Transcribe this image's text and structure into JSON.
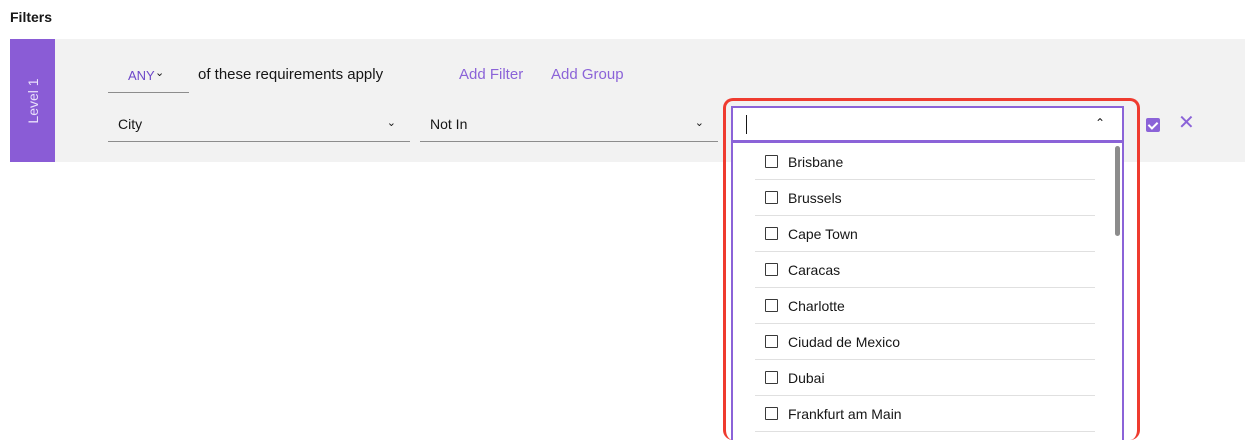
{
  "header": {
    "title": "Filters"
  },
  "level": {
    "label": "Level 1"
  },
  "requirement": {
    "quantifier": "ANY",
    "text": "of these requirements apply",
    "add_filter": "Add Filter",
    "add_group": "Add Group"
  },
  "filter": {
    "field_value": "City",
    "operator_value": "Not In",
    "search_value": ""
  },
  "options": [
    {
      "label": "Brisbane",
      "checked": false
    },
    {
      "label": "Brussels",
      "checked": false
    },
    {
      "label": "Cape Town",
      "checked": false
    },
    {
      "label": "Caracas",
      "checked": false
    },
    {
      "label": "Charlotte",
      "checked": false
    },
    {
      "label": "Ciudad de Mexico",
      "checked": false
    },
    {
      "label": "Dubai",
      "checked": false
    },
    {
      "label": "Frankfurt am Main",
      "checked": false
    }
  ],
  "icons": {
    "apply": "checkbox-checked-icon",
    "close": "close-icon"
  },
  "colors": {
    "accent": "#8b63d8",
    "level_tab": "#8a5cd6",
    "highlight": "#ef3b2f"
  }
}
